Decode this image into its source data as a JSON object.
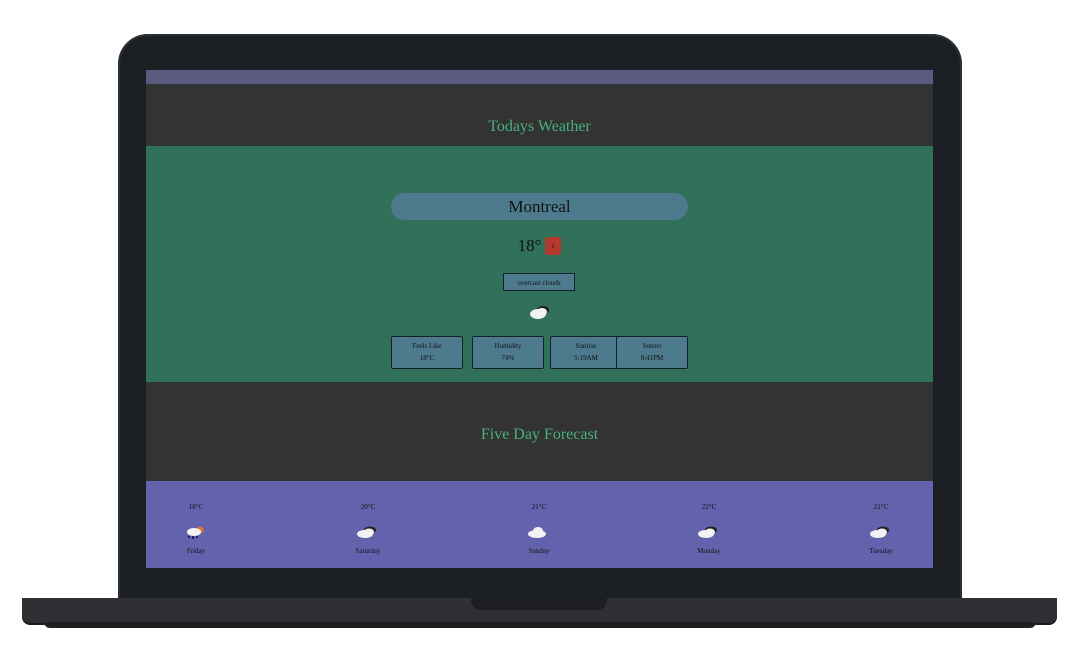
{
  "page_title_today": "Todays Weather",
  "city": "Montreal",
  "current": {
    "temp": "18°",
    "unit_toggle": "c",
    "description": "overcast clouds",
    "icon": "broken-clouds-icon"
  },
  "stats": [
    {
      "label": "Feels Like",
      "value": "18°C"
    },
    {
      "label": "Humidity",
      "value": "74%"
    },
    {
      "label": "Sunrise",
      "value": "5:19AM"
    },
    {
      "label": "Sunset",
      "value": "8:41PM"
    }
  ],
  "forecast_title": "Five Day Forecast",
  "forecast": [
    {
      "temp": "18°C",
      "day": "Friday",
      "icon": "rain-sun-icon"
    },
    {
      "temp": "20°C",
      "day": "Saturday",
      "icon": "broken-clouds-icon"
    },
    {
      "temp": "21°C",
      "day": "Sunday",
      "icon": "cloud-icon"
    },
    {
      "temp": "22°C",
      "day": "Monday",
      "icon": "broken-clouds-icon"
    },
    {
      "temp": "21°C",
      "day": "Tuesday",
      "icon": "broken-clouds-icon"
    }
  ],
  "colors": {
    "title": "#49b07e",
    "today_bg": "#317059",
    "forecast_bg": "#6362ad",
    "card_bg": "#4e7a8e",
    "toggle_bg": "#b6392d"
  }
}
